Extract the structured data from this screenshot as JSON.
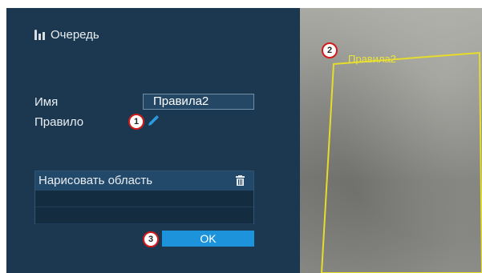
{
  "panel": {
    "title": "Очередь",
    "name_label": "Имя",
    "name_value": "Правила2",
    "rule_label": "Правило",
    "region_header": "Нарисовать область",
    "ok_label": "OK"
  },
  "markers": {
    "m1": "1",
    "m2": "2",
    "m3": "3"
  },
  "video": {
    "region_label": "Правила2",
    "region_color": "#e6dc2a"
  },
  "colors": {
    "panel_bg": "#1c3850",
    "accent": "#1d93dc",
    "marker_border": "#d21b1b"
  }
}
